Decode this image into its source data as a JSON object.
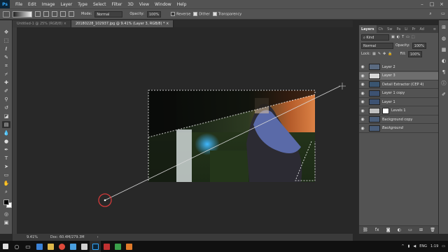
{
  "menubar": {
    "logo": "Ps",
    "items": [
      "File",
      "Edit",
      "Image",
      "Layer",
      "Type",
      "Select",
      "Filter",
      "3D",
      "View",
      "Window",
      "Help"
    ]
  },
  "options": {
    "mode_label": "Mode:",
    "mode_value": "Normal",
    "opacity_label": "Opacity:",
    "opacity_value": "100%",
    "reverse_label": "Reverse",
    "dither_label": "Dither",
    "transparency_label": "Transparency"
  },
  "tabs": [
    {
      "label": "Untitled-1 @ 25% (RGB/8) ×",
      "active": false
    },
    {
      "label": "20180228_102937.jpg @ 9.41% (Layer 3, RGB/8) * ×",
      "active": true
    }
  ],
  "status": {
    "zoom": "9.41%",
    "doc": "Doc: 60.4M/279.3M"
  },
  "layers_panel": {
    "tabs": [
      "Layers",
      "Ch",
      "Sw",
      "Pa",
      "Li",
      "Pr",
      "Ad"
    ],
    "filter_label": "Kind",
    "blend_mode": "Normal",
    "opacity_label": "Opacity:",
    "opacity_value": "100%",
    "lock_label": "Lock:",
    "fill_label": "Fill:",
    "fill_value": "100%",
    "layers": [
      {
        "name": "Layer 2",
        "thumb": "#5a6a80",
        "mask": false,
        "selected": false,
        "italic": false
      },
      {
        "name": "Layer 3",
        "thumb": "#d8d8d8",
        "mask": false,
        "selected": true,
        "italic": false
      },
      {
        "name": "Detail Extractor (CEP 4)",
        "thumb": "#3a5570",
        "mask": false,
        "selected": false,
        "italic": false
      },
      {
        "name": "Layer 1 copy",
        "thumb": "#3d5272",
        "mask": false,
        "selected": false,
        "italic": false
      },
      {
        "name": "Layer 1",
        "thumb": "#3d5272",
        "mask": false,
        "selected": false,
        "italic": false
      },
      {
        "name": "Levels 1",
        "thumb": "#bfbfbf",
        "mask": true,
        "selected": false,
        "italic": false
      },
      {
        "name": "Background copy",
        "thumb": "#4a5d78",
        "mask": false,
        "selected": false,
        "italic": false
      },
      {
        "name": "Background",
        "thumb": "#4a5d78",
        "mask": false,
        "selected": false,
        "italic": true
      }
    ],
    "footer_icons": [
      "link-icon",
      "fx-icon",
      "mask-icon",
      "adjustment-icon",
      "folder-icon",
      "new-layer-icon",
      "trash-icon"
    ]
  },
  "taskbar": {
    "language": "ENG",
    "time": "1:19"
  },
  "colors": {
    "ps_blue": "#31a8ff",
    "selection_glow": "#ff7a3a",
    "drag_circle": "#d23a3a"
  }
}
